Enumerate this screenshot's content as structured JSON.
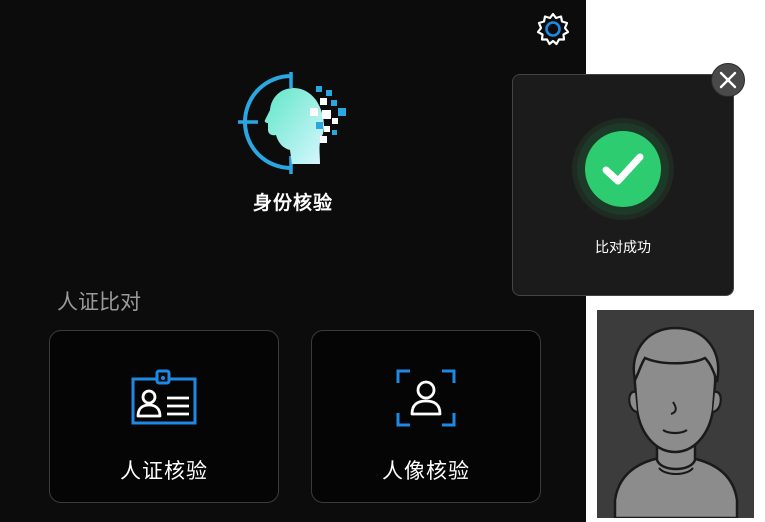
{
  "app": {
    "title": "身份核验",
    "settings_icon": "gear-icon",
    "logo_icon": "face-scan-logo-icon"
  },
  "section": {
    "label": "人证比对"
  },
  "cards": [
    {
      "label": "人证核验",
      "icon": "id-card-icon"
    },
    {
      "label": "人像核验",
      "icon": "face-frame-icon"
    }
  ],
  "popup": {
    "message": "比对成功",
    "status_icon": "check-icon",
    "close_icon": "close-icon"
  },
  "photo": {
    "icon": "person-portrait"
  },
  "colors": {
    "accent_blue": "#1e88e5",
    "success_green": "#2ecc71",
    "background": "#0c0c0c"
  }
}
